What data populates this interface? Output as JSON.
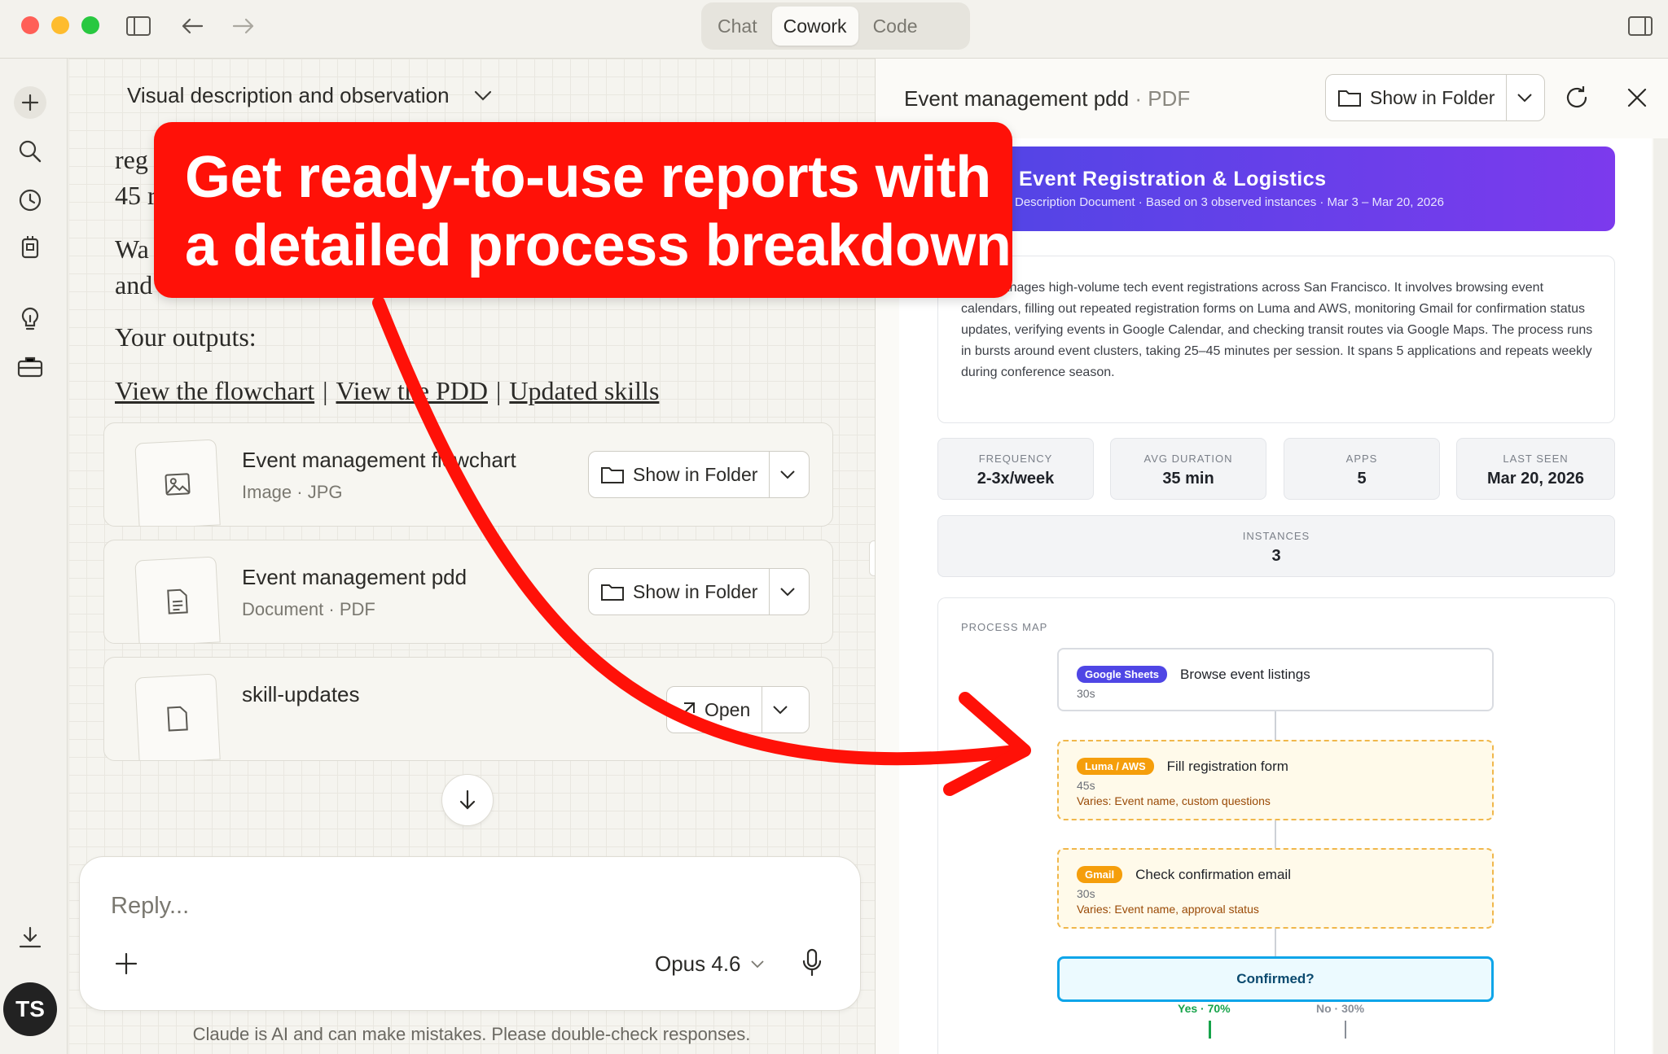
{
  "window": {
    "modes": [
      "Chat",
      "Cowork",
      "Code"
    ],
    "active_mode": "Cowork",
    "icons": [
      "close-dot",
      "minimize-dot",
      "maximize-dot",
      "sidebar-toggle-icon",
      "back-arrow-icon",
      "forward-arrow-icon",
      "panel-toggle-icon"
    ]
  },
  "rail": {
    "icons": [
      "new-chat-plus-icon",
      "search-icon",
      "history-clock-icon",
      "device-icon",
      "idea-bulb-icon",
      "toolbox-icon",
      "download-icon"
    ],
    "avatar_initials": "TS"
  },
  "chat": {
    "section_title": "Visual description and observation",
    "partial_lines": [
      "reg",
      "45 r",
      "Wa",
      "and"
    ],
    "outputs_label": "Your outputs:",
    "links": [
      "View the flowchart",
      "View the PDD",
      "Updated skills"
    ],
    "link_separator": "|",
    "files": [
      {
        "title": "Event management flowchart",
        "type": "Image",
        "ext": "JPG",
        "action": "Show in Folder",
        "icon": "image-icon"
      },
      {
        "title": "Event management pdd",
        "type": "Document",
        "ext": "PDF",
        "action": "Show in Folder",
        "icon": "document-icon"
      },
      {
        "title": "skill-updates",
        "type": "",
        "ext": "",
        "action": "Open",
        "icon": "file-icon"
      }
    ],
    "meta_separator": "·",
    "reply_placeholder": "Reply...",
    "model": "Opus 4.6",
    "disclaimer": "Claude is AI and can make mistakes. Please double-check responses."
  },
  "doc": {
    "title": "Event management pdd",
    "type": "PDF",
    "show_in_folder": "Show in Folder",
    "header": {
      "title": "Event Registration & Logistics",
      "subtitle": "Description Document · Based on 3 observed instances · Mar 3 – Mar 20, 2026",
      "gradient": [
        "#4f46e5",
        "#7c3aed"
      ]
    },
    "summary": "cess manages high-volume tech event registrations across San Francisco. It involves browsing event calendars, filling out repeated registration forms on Luma and AWS, monitoring Gmail for confirmation status updates, verifying events in Google Calendar, and checking transit routes via Google Maps. The process runs in bursts around event clusters, taking 25–45 minutes per session. It spans 5 applications and repeats weekly during conference season.",
    "stats": [
      {
        "label": "FREQUENCY",
        "value": "2-3x/week"
      },
      {
        "label": "AVG DURATION",
        "value": "35 min"
      },
      {
        "label": "APPS",
        "value": "5"
      },
      {
        "label": "LAST SEEN",
        "value": "Mar 20, 2026"
      }
    ],
    "instances": {
      "label": "INSTANCES",
      "value": "3"
    },
    "process_map": {
      "label": "PROCESS MAP",
      "steps": [
        {
          "app": "Google Sheets",
          "app_color": "#4f46e5",
          "action": "Browse event listings",
          "time": "30s",
          "varies": ""
        },
        {
          "app": "Luma / AWS",
          "app_color": "#f59e0b",
          "action": "Fill registration form",
          "time": "45s",
          "varies": "Varies: Event name, custom questions"
        },
        {
          "app": "Gmail",
          "app_color": "#f59e0b",
          "action": "Check confirmation email",
          "time": "30s",
          "varies": "Varies: Event name, approval status"
        }
      ],
      "decision": {
        "label": "Confirmed?",
        "yes": "Yes · 70%",
        "no": "No · 30%"
      }
    }
  },
  "overlay": {
    "banner_text": "Get ready-to-use reports with\na detailed process breakdown",
    "banner_color": "#ff1108"
  }
}
